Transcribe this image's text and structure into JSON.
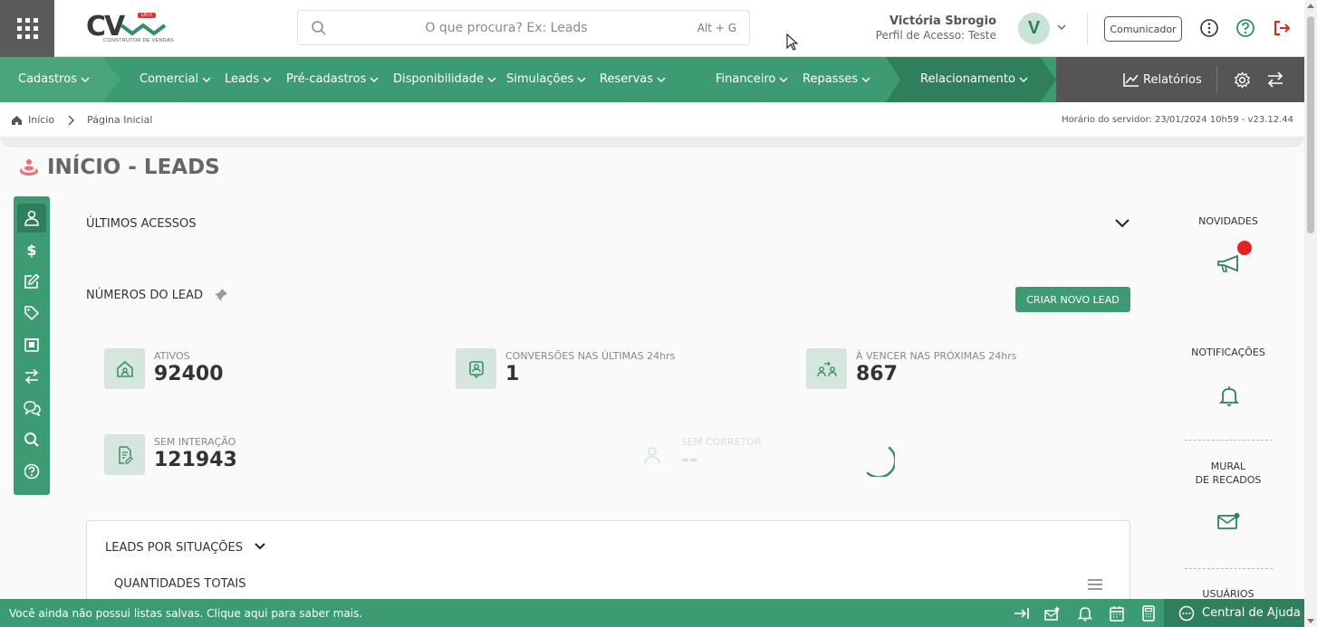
{
  "header": {
    "logo_text": "CV",
    "logo_badge": "DEV",
    "logo_subtitle": "CONSTRUTOR DE VENDAS",
    "search_placeholder": "O que procura? Ex: Leads",
    "search_shortcut": "Alt + G",
    "user_name": "Victória Sbrogio",
    "user_profile": "Perfil de Acesso: Teste",
    "avatar_initial": "V",
    "comunicador_label": "Comunicador"
  },
  "nav": {
    "items": [
      {
        "label": "Cadastros"
      },
      {
        "label": "Comercial"
      },
      {
        "label": "Leads"
      },
      {
        "label": "Pré-cadastros"
      },
      {
        "label": "Disponibilidade"
      },
      {
        "label": "Simulações"
      },
      {
        "label": "Reservas"
      },
      {
        "label": "Financeiro"
      },
      {
        "label": "Repasses"
      },
      {
        "label": "Relacionamento"
      }
    ],
    "reports_label": "Relatórios"
  },
  "breadcrumb": {
    "home": "Início",
    "current": "Página Inicial",
    "server_time": "Horário do servidor: 23/01/2024 10h59 - v23.12.44"
  },
  "page": {
    "title": "INÍCIO - LEADS"
  },
  "main": {
    "recent_access_label": "ÚLTIMOS ACESSOS",
    "lead_numbers_label": "NÚMEROS DO LEAD",
    "create_lead_label": "CRIAR NOVO LEAD",
    "stats": [
      {
        "label": "ATIVOS",
        "value": "92400"
      },
      {
        "label": "CONVERSÕES NAS ÚLTIMAS 24hrs",
        "value": "1"
      },
      {
        "label": "À VENCER NAS PRÓXIMAS 24hrs",
        "value": "867"
      },
      {
        "label": "SEM INTERAÇÃO",
        "value": "121943"
      },
      {
        "label": "SEM CORRETOR",
        "value": "--"
      }
    ],
    "situations_label": "LEADS POR SITUAÇÕES",
    "totals_label": "QUANTIDADES TOTAIS"
  },
  "rail": {
    "news_label": "NOVIDADES",
    "notifications_label": "NOTIFICAÇÕES",
    "mural_label_1": "MURAL",
    "mural_label_2": "DE RECADOS",
    "users_label": "USUÁRIOS"
  },
  "footer": {
    "message": "Você ainda não possui listas salvas. Clique aqui para saber mais.",
    "help_label": "Central de Ajuda"
  },
  "colors": {
    "primary": "#3d9b73",
    "primary_dark": "#2f7f5c",
    "nav_gray": "#555555",
    "alert_red": "#e32222"
  }
}
